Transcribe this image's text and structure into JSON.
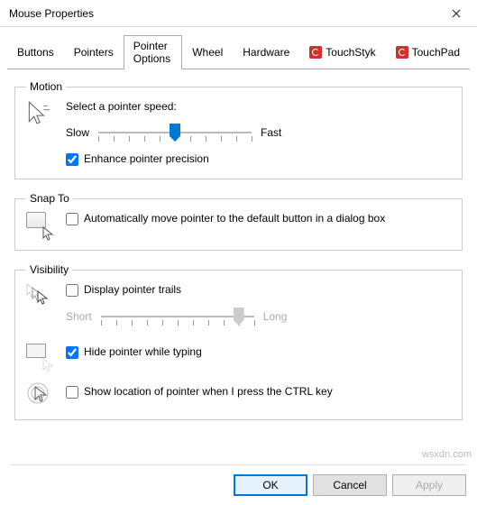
{
  "window": {
    "title": "Mouse Properties"
  },
  "tabs": {
    "buttons": "Buttons",
    "pointers": "Pointers",
    "pointer_options": "Pointer Options",
    "wheel": "Wheel",
    "hardware": "Hardware",
    "touchstyk": "TouchStyk",
    "touchpad": "TouchPad",
    "active": "pointer_options"
  },
  "motion": {
    "legend": "Motion",
    "select_label": "Select a pointer speed:",
    "slow": "Slow",
    "fast": "Fast",
    "speed_value": 6,
    "speed_max": 11,
    "enhance_label": "Enhance pointer precision",
    "enhance_checked": true
  },
  "snap": {
    "legend": "Snap To",
    "label": "Automatically move pointer to the default button in a dialog box",
    "checked": false
  },
  "visibility": {
    "legend": "Visibility",
    "trails_label": "Display pointer trails",
    "trails_checked": false,
    "short": "Short",
    "long": "Long",
    "trail_value": 10,
    "trail_max": 11,
    "hide_label": "Hide pointer while typing",
    "hide_checked": true,
    "ctrl_label": "Show location of pointer when I press the CTRL key",
    "ctrl_checked": false
  },
  "buttons_bar": {
    "ok": "OK",
    "cancel": "Cancel",
    "apply": "Apply"
  },
  "watermark": "wsxdn.com"
}
